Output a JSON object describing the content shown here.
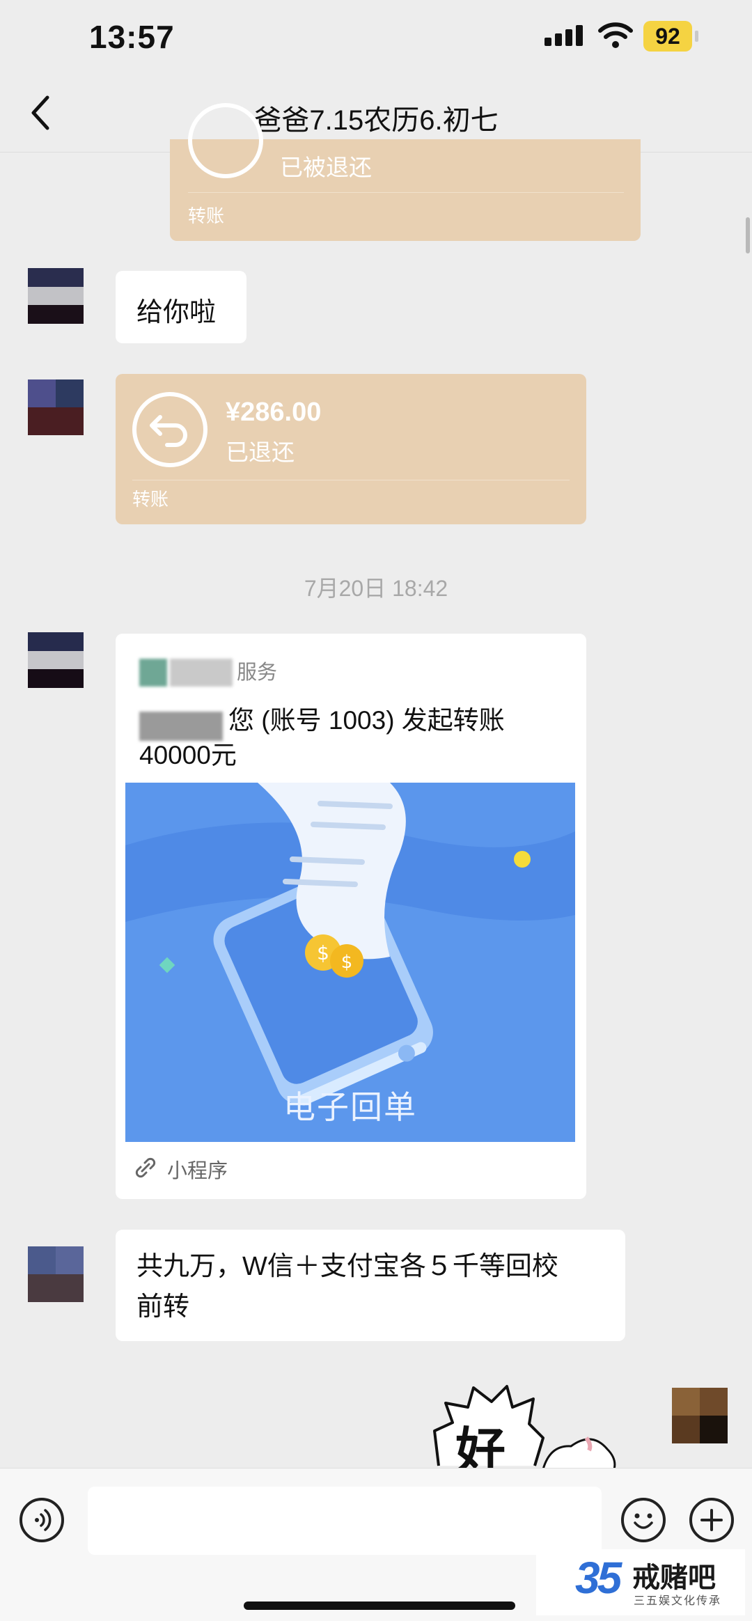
{
  "status_bar": {
    "time": "13:57",
    "battery": "92",
    "icons": [
      "signal-icon",
      "wifi-icon",
      "battery-icon"
    ]
  },
  "nav": {
    "title": "爸爸7.15农历6.初七",
    "back_icon": "chevron-left-icon"
  },
  "messages": {
    "transfer_top": {
      "status": "已被退还",
      "type_label": "转账"
    },
    "text_1": "给你啦",
    "transfer_2": {
      "amount": "¥286.00",
      "status": "已退还",
      "type_label": "转账"
    },
    "timestamp": "7月20日 18:42",
    "service_card": {
      "source": "服务",
      "message_line1": "您 (账号 1003) 发起转账",
      "message_line2": "40000元",
      "image_caption": "电子回单",
      "footer_label": "小程序"
    },
    "text_2_line1": "共九万，W信＋支付宝各５千等回校",
    "text_2_line2": "前转",
    "sticker_text": "好"
  },
  "input_bar": {
    "voice_icon": "voice-icon",
    "emoji_icon": "emoji-icon",
    "plus_icon": "plus-icon"
  },
  "watermark": {
    "number": "35",
    "brand": "戒赌吧",
    "tagline": "三五娱文化传承"
  },
  "colors": {
    "background": "#ededed",
    "transfer_card": "#e8d0b2",
    "receipt_blue": "#5b96ec",
    "battery": "#f5d342"
  }
}
